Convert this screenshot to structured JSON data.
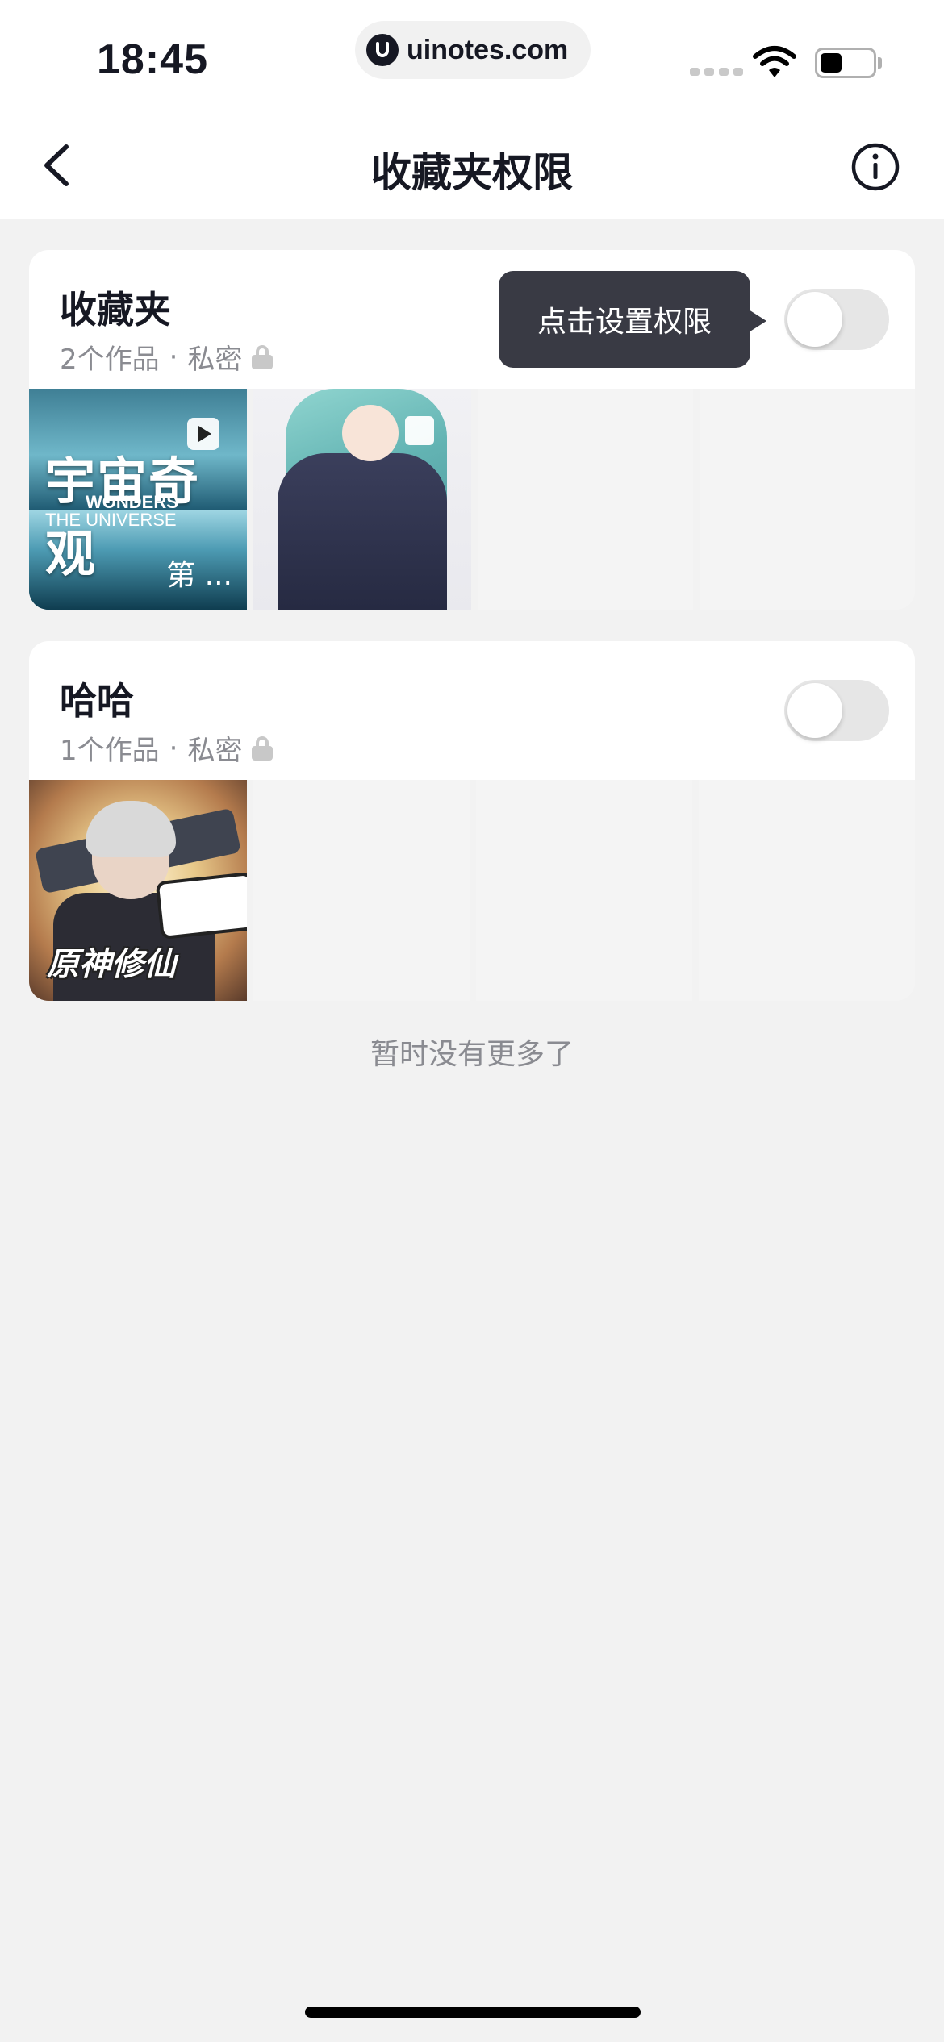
{
  "status_bar": {
    "time": "18:45",
    "url": "uinotes.com",
    "battery_level": 0.4
  },
  "nav": {
    "title": "收藏夹权限",
    "back_icon": "chevron-left-icon",
    "info_icon": "info-circle-icon"
  },
  "tooltip": {
    "text": "点击设置权限"
  },
  "folders": [
    {
      "name": "收藏夹",
      "count_text": "2个作品",
      "separator": "·",
      "privacy": "私密",
      "toggle_on": false,
      "thumbnails": [
        {
          "title_cn": "宇宙奇观",
          "title_en_1": "WONDERS",
          "title_en_2": "THE UNIVERSE",
          "episode": "第 ...",
          "icon": "play-icon"
        },
        {
          "icon": "stop-icon"
        }
      ]
    },
    {
      "name": "哈哈",
      "count_text": "1个作品",
      "separator": "·",
      "privacy": "私密",
      "toggle_on": false,
      "thumbnails": [
        {
          "caption": "原神修仙"
        }
      ]
    }
  ],
  "footer": {
    "no_more_text": "暂时没有更多了"
  }
}
